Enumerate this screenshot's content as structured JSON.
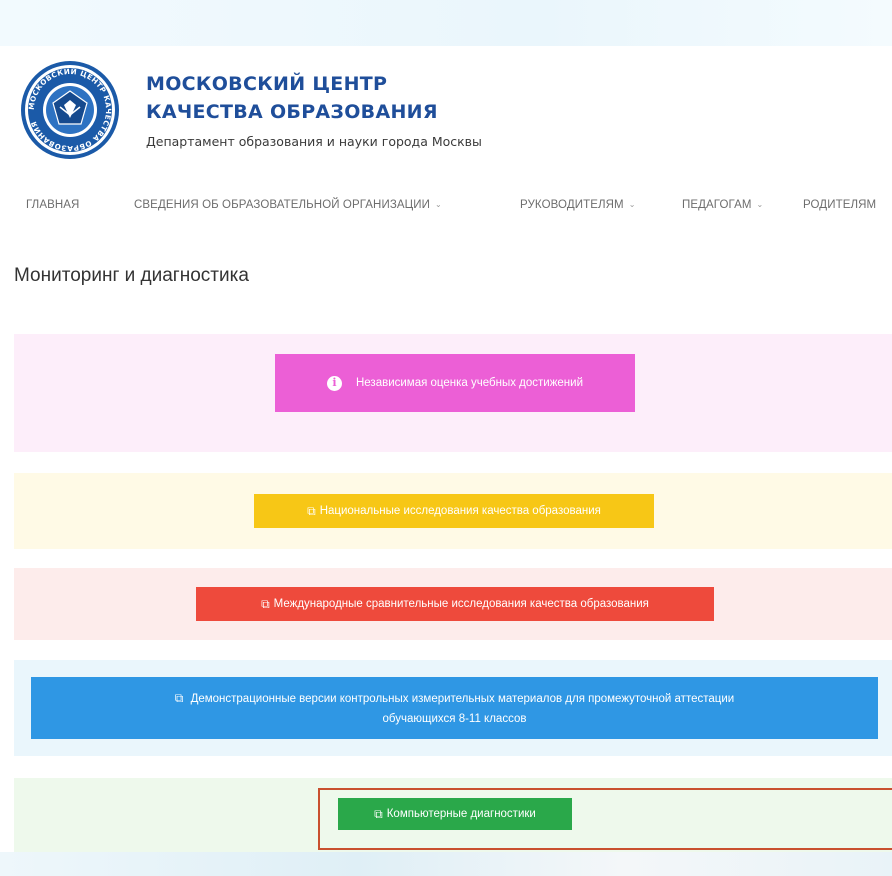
{
  "header": {
    "org_name_line1": "МОСКОВСКИЙ ЦЕНТР",
    "org_name_line2": "КАЧЕСТВА ОБРАЗОВАНИЯ",
    "subtitle": "Департамент образования и науки города Москвы",
    "logo_text": "МОСКОВСКИЙ ЦЕНТР КАЧЕСТВА ОБРАЗОВАНИЯ"
  },
  "nav": {
    "items": [
      {
        "label": "ГЛАВНАЯ",
        "has_dropdown": false
      },
      {
        "label": "СВЕДЕНИЯ ОБ ОБРАЗОВАТЕЛЬНОЙ ОРГАНИЗАЦИИ",
        "has_dropdown": true
      },
      {
        "label": "РУКОВОДИТЕЛЯМ",
        "has_dropdown": true
      },
      {
        "label": "ПЕДАГОГАМ",
        "has_dropdown": true
      },
      {
        "label": "РОДИТЕЛЯМ",
        "has_dropdown": false
      }
    ],
    "chevron": "⌄"
  },
  "main": {
    "title": "Мониторинг и диагностика",
    "sections": [
      {
        "label": "Независимая оценка учебных достижений",
        "icon": "info-circle-icon",
        "panel_color": "#fdeefa",
        "button_color": "#ec5fd6"
      },
      {
        "label": "Национальные исследования качества образования",
        "icon": "external-link-icon",
        "panel_color": "#fffae6",
        "button_color": "#f7c716"
      },
      {
        "label": "Международные сравнительные исследования качества образования",
        "icon": "external-link-icon",
        "panel_color": "#fdeceb",
        "button_color": "#ee4a3c"
      },
      {
        "label_line1": "Демонстрационные версии контрольных измерительных материалов для промежуточной аттестации",
        "label_line2": "обучающихся 8-11 классов",
        "icon": "external-link-icon",
        "panel_color": "#eaf6fc",
        "button_color": "#2f97e4"
      },
      {
        "label": "Компьютерные диагностики",
        "icon": "external-link-icon",
        "panel_color": "#eef9ec",
        "button_color": "#2aa84a",
        "highlight_color": "#c9502f"
      }
    ],
    "ext_glyph": "⧉",
    "info_glyph": "i"
  }
}
